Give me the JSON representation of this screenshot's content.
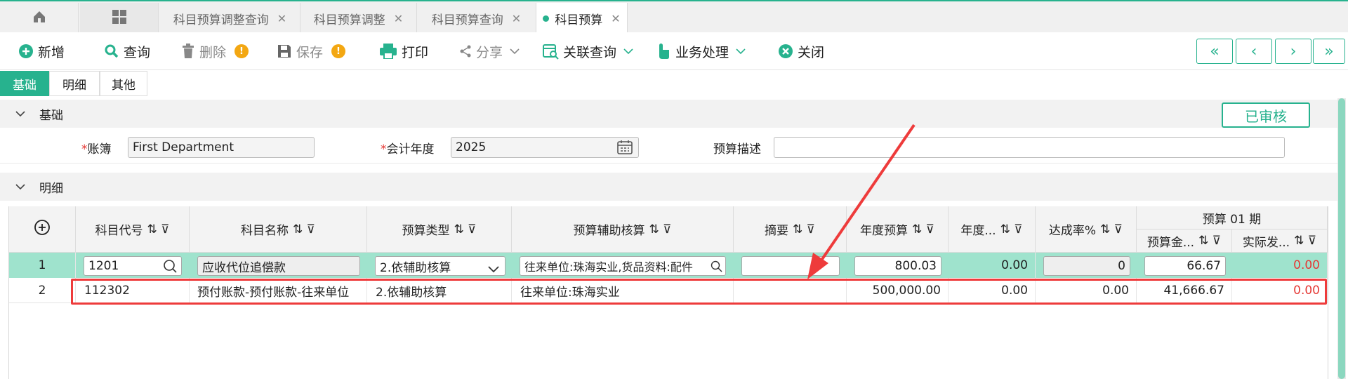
{
  "tabs": [
    {
      "label": "科目预算调整查询"
    },
    {
      "label": "科目预算调整"
    },
    {
      "label": "科目预算查询"
    },
    {
      "label": "科目预算"
    }
  ],
  "toolbar": {
    "new": "新增",
    "query": "查询",
    "delete": "删除",
    "save": "保存",
    "print": "打印",
    "share": "分享",
    "related": "关联查询",
    "business": "业务处理",
    "close": "关闭",
    "warn_mark": "!"
  },
  "nav": {
    "first": "«",
    "prev": "‹",
    "next": "›",
    "last": "»"
  },
  "subtabs": [
    "基础",
    "明细",
    "其他"
  ],
  "basic": {
    "section": "基础",
    "status": "已审核",
    "ledger_label": "账簿",
    "ledger_value": "First Department",
    "year_label": "会计年度",
    "year_value": "2025",
    "desc_label": "预算描述",
    "desc_value": "",
    "req": "*"
  },
  "detail": {
    "section": "明细",
    "columns": [
      "科目代号",
      "科目名称",
      "预算类型",
      "预算辅助核算",
      "摘要",
      "年度预算",
      "年度...",
      "达成率%"
    ],
    "period_header": "预算 01 期",
    "period_cols": [
      "预算金...",
      "实际发..."
    ],
    "rows": [
      {
        "no": "1",
        "code": "1201",
        "name": "应收代位追偿款",
        "type": "2.依辅助核算",
        "aux": "往来单位:珠海实业,货品资料:配件",
        "summary": "",
        "annual": "800.03",
        "annual2": "0.00",
        "rate": "0",
        "budget": "66.67",
        "actual": "0.00"
      },
      {
        "no": "2",
        "code": "112302",
        "name": "预付账款-预付账款-往来单位",
        "type": "2.依辅助核算",
        "aux": "往来单位:珠海实业",
        "summary": "",
        "annual": "500,000.00",
        "annual2": "0.00",
        "rate": "0.00",
        "budget": "41,666.67",
        "actual": "0.00"
      }
    ]
  },
  "colors": {
    "accent": "#27b28e",
    "row_selected": "#9fe3cd",
    "annotation": "#ee3b3b",
    "negative": "#e53935"
  }
}
